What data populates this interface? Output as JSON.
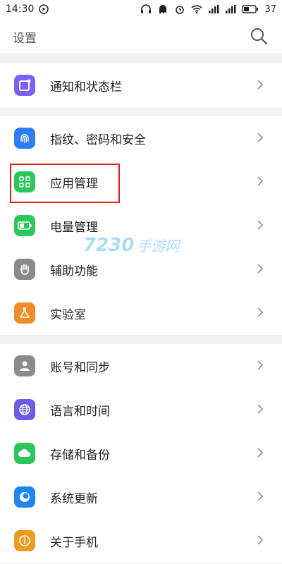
{
  "status_bar": {
    "time": "14:30",
    "battery": "37"
  },
  "header": {
    "title": "设置"
  },
  "sections": [
    {
      "items": [
        {
          "label": "通知和状态栏",
          "icon": "notification-icon",
          "color": "#7b61ff"
        }
      ]
    },
    {
      "items": [
        {
          "label": "指纹、密码和安全",
          "icon": "fingerprint-icon",
          "color": "#2f7df6"
        },
        {
          "label": "应用管理",
          "icon": "apps-grid-icon",
          "color": "#2dc65b"
        },
        {
          "label": "电量管理",
          "icon": "battery-icon",
          "color": "#2dc65b"
        },
        {
          "label": "辅助功能",
          "icon": "hand-icon",
          "color": "#8a8a8a"
        },
        {
          "label": "实验室",
          "icon": "flask-icon",
          "color": "#f08c2a"
        }
      ]
    },
    {
      "items": [
        {
          "label": "账号和同步",
          "icon": "account-icon",
          "color": "#8a8a8a"
        },
        {
          "label": "语言和时间",
          "icon": "globe-icon",
          "color": "#6a5ce8"
        },
        {
          "label": "存储和备份",
          "icon": "cloud-icon",
          "color": "#2dc65b"
        },
        {
          "label": "系统更新",
          "icon": "update-icon",
          "color": "#1e86f0"
        },
        {
          "label": "关于手机",
          "icon": "info-icon",
          "color": "#f09a1f"
        }
      ]
    }
  ],
  "watermark": {
    "number": "7230",
    "text": "手游网"
  }
}
